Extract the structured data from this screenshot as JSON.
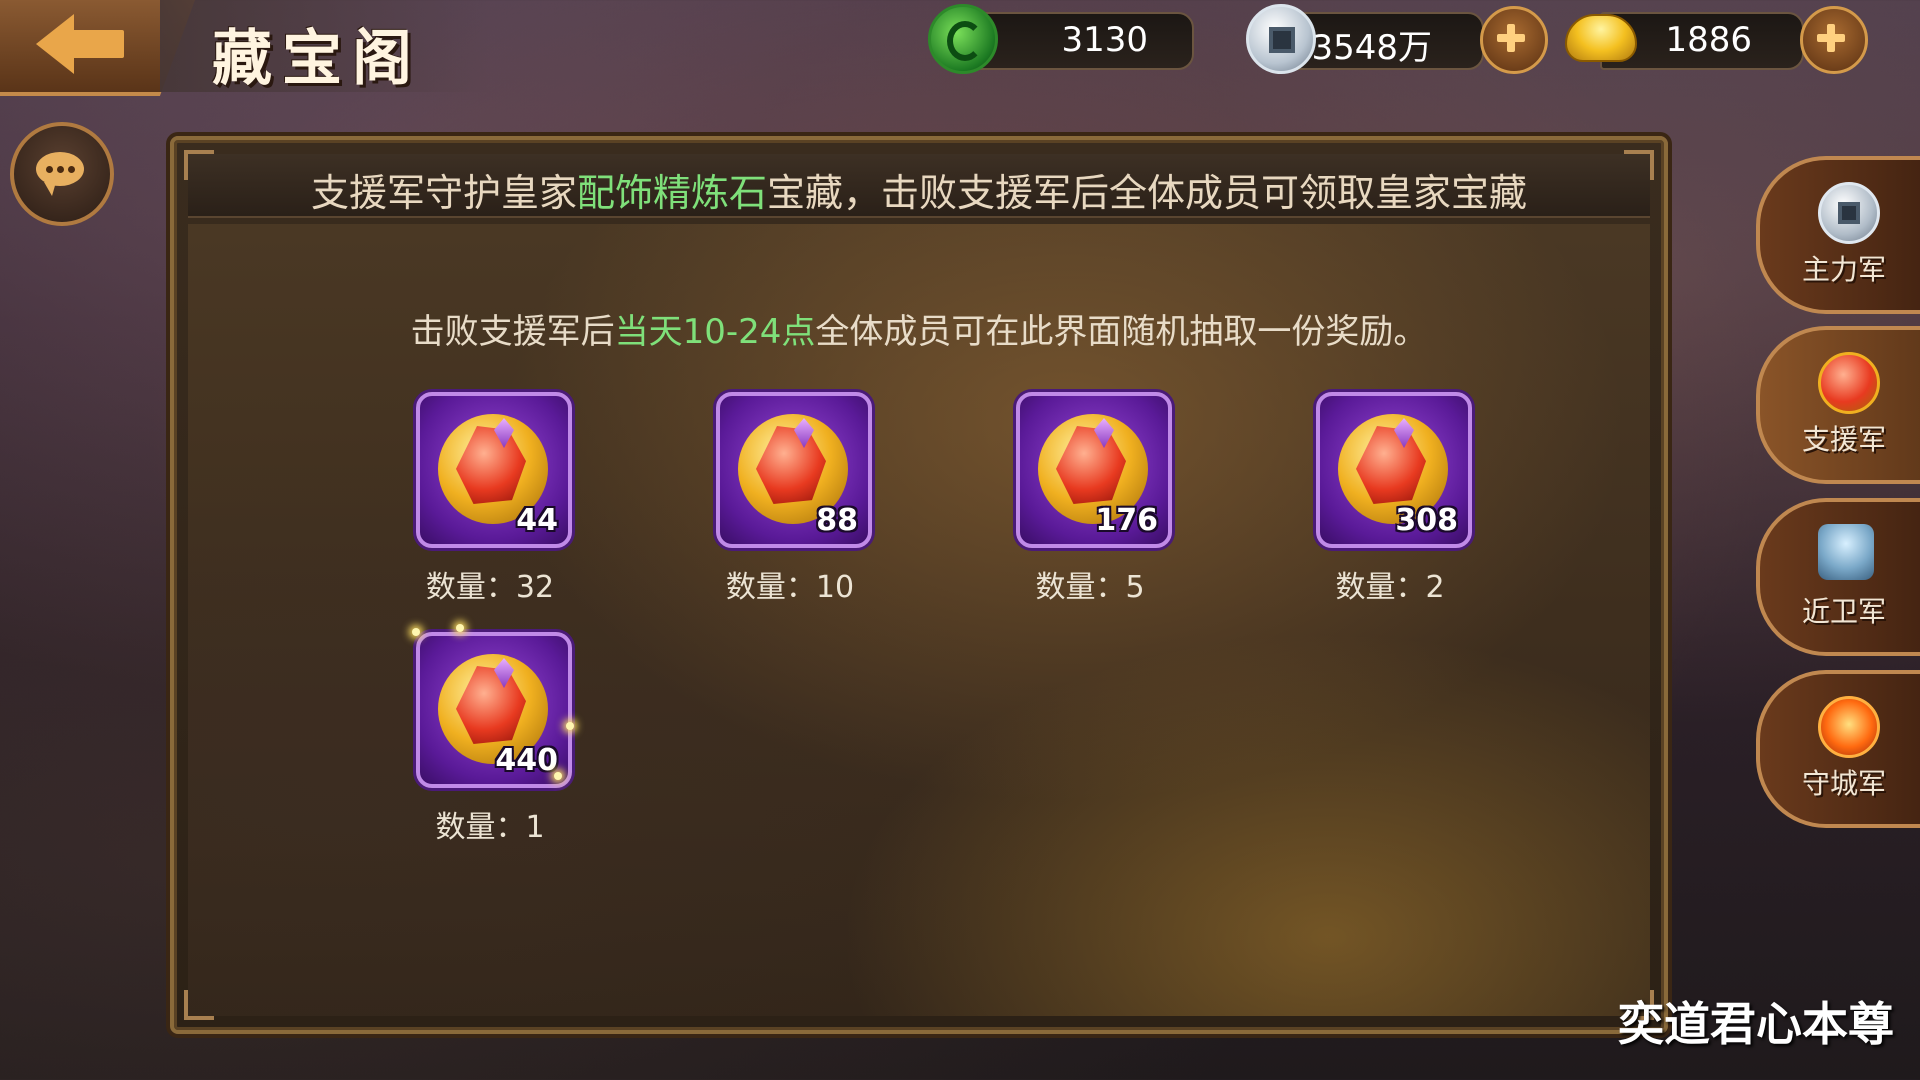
{
  "header": {
    "title": "藏宝阁",
    "resources": {
      "jade": "3130",
      "coins": "3548万",
      "gold": "1886"
    }
  },
  "panel": {
    "notice_pre": "支援军守护皇家",
    "notice_highlight": "配饰精炼石",
    "notice_post": "宝藏，击败支援军后全体成员可领取皇家宝藏",
    "sub_pre": "击败支援军后",
    "sub_highlight": "当天10-24点",
    "sub_post": "全体成员可在此界面随机抽取一份奖励。",
    "rewards": [
      {
        "amount": "44",
        "qty": "数量：32"
      },
      {
        "amount": "88",
        "qty": "数量：10"
      },
      {
        "amount": "176",
        "qty": "数量：5"
      },
      {
        "amount": "308",
        "qty": "数量：2"
      },
      {
        "amount": "440",
        "qty": "数量：1"
      }
    ]
  },
  "tabs": [
    {
      "label": "主力军",
      "icon": "coin-icon"
    },
    {
      "label": "支援军",
      "icon": "gem-icon"
    },
    {
      "label": "近卫军",
      "icon": "lion-statue-icon"
    },
    {
      "label": "守城军",
      "icon": "fire-orb-icon"
    }
  ],
  "watermark": "奕道君心本尊",
  "colors": {
    "highlight": "#7fe07a",
    "tile": "#5a1a98",
    "frame": "#8a6a3a"
  }
}
